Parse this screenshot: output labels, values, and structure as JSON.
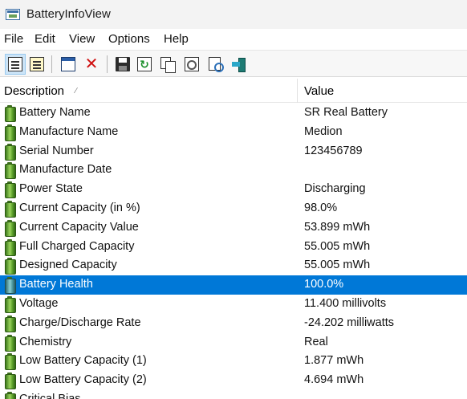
{
  "window": {
    "title": "BatteryInfoView",
    "app_icon": "app-window-icon"
  },
  "menu": [
    {
      "label": "File"
    },
    {
      "label": "Edit"
    },
    {
      "label": "View"
    },
    {
      "label": "Options"
    },
    {
      "label": "Help"
    }
  ],
  "toolbar": [
    {
      "icon": "battery-info-mode-icon",
      "active": true
    },
    {
      "icon": "battery-log-mode-icon",
      "active": false
    },
    {
      "icon": "window-icon",
      "active": false
    },
    {
      "icon": "close-icon",
      "active": false
    },
    {
      "icon": "save-icon",
      "active": false
    },
    {
      "icon": "refresh-icon",
      "active": false
    },
    {
      "icon": "copy-icon",
      "active": false
    },
    {
      "icon": "html-report-icon",
      "active": false
    },
    {
      "icon": "find-icon",
      "active": false
    },
    {
      "icon": "exit-icon",
      "active": false
    }
  ],
  "table": {
    "columns": [
      "Description",
      "Value"
    ],
    "sort_indicator": "⁄",
    "selected_row": 9,
    "rows": [
      {
        "description": "Battery Name",
        "value": "SR Real Battery"
      },
      {
        "description": "Manufacture Name",
        "value": "Medion"
      },
      {
        "description": "Serial Number",
        "value": "123456789"
      },
      {
        "description": "Manufacture Date",
        "value": ""
      },
      {
        "description": "Power State",
        "value": "Discharging"
      },
      {
        "description": "Current Capacity (in %)",
        "value": "98.0%"
      },
      {
        "description": "Current Capacity Value",
        "value": "53.899 mWh"
      },
      {
        "description": "Full Charged Capacity",
        "value": "55.005 mWh"
      },
      {
        "description": "Designed Capacity",
        "value": "55.005 mWh"
      },
      {
        "description": "Battery Health",
        "value": "100.0%"
      },
      {
        "description": "Voltage",
        "value": "11.400 millivolts"
      },
      {
        "description": "Charge/Discharge Rate",
        "value": "-24.202 milliwatts"
      },
      {
        "description": "Chemistry",
        "value": "Real"
      },
      {
        "description": "Low Battery Capacity (1)",
        "value": "1.877 mWh"
      },
      {
        "description": "Low Battery Capacity (2)",
        "value": "4.694 mWh"
      },
      {
        "description": "Critical Bias",
        "value": ""
      }
    ]
  },
  "colors": {
    "selection": "#0078d7",
    "battery_icon": "#5ea12c"
  }
}
